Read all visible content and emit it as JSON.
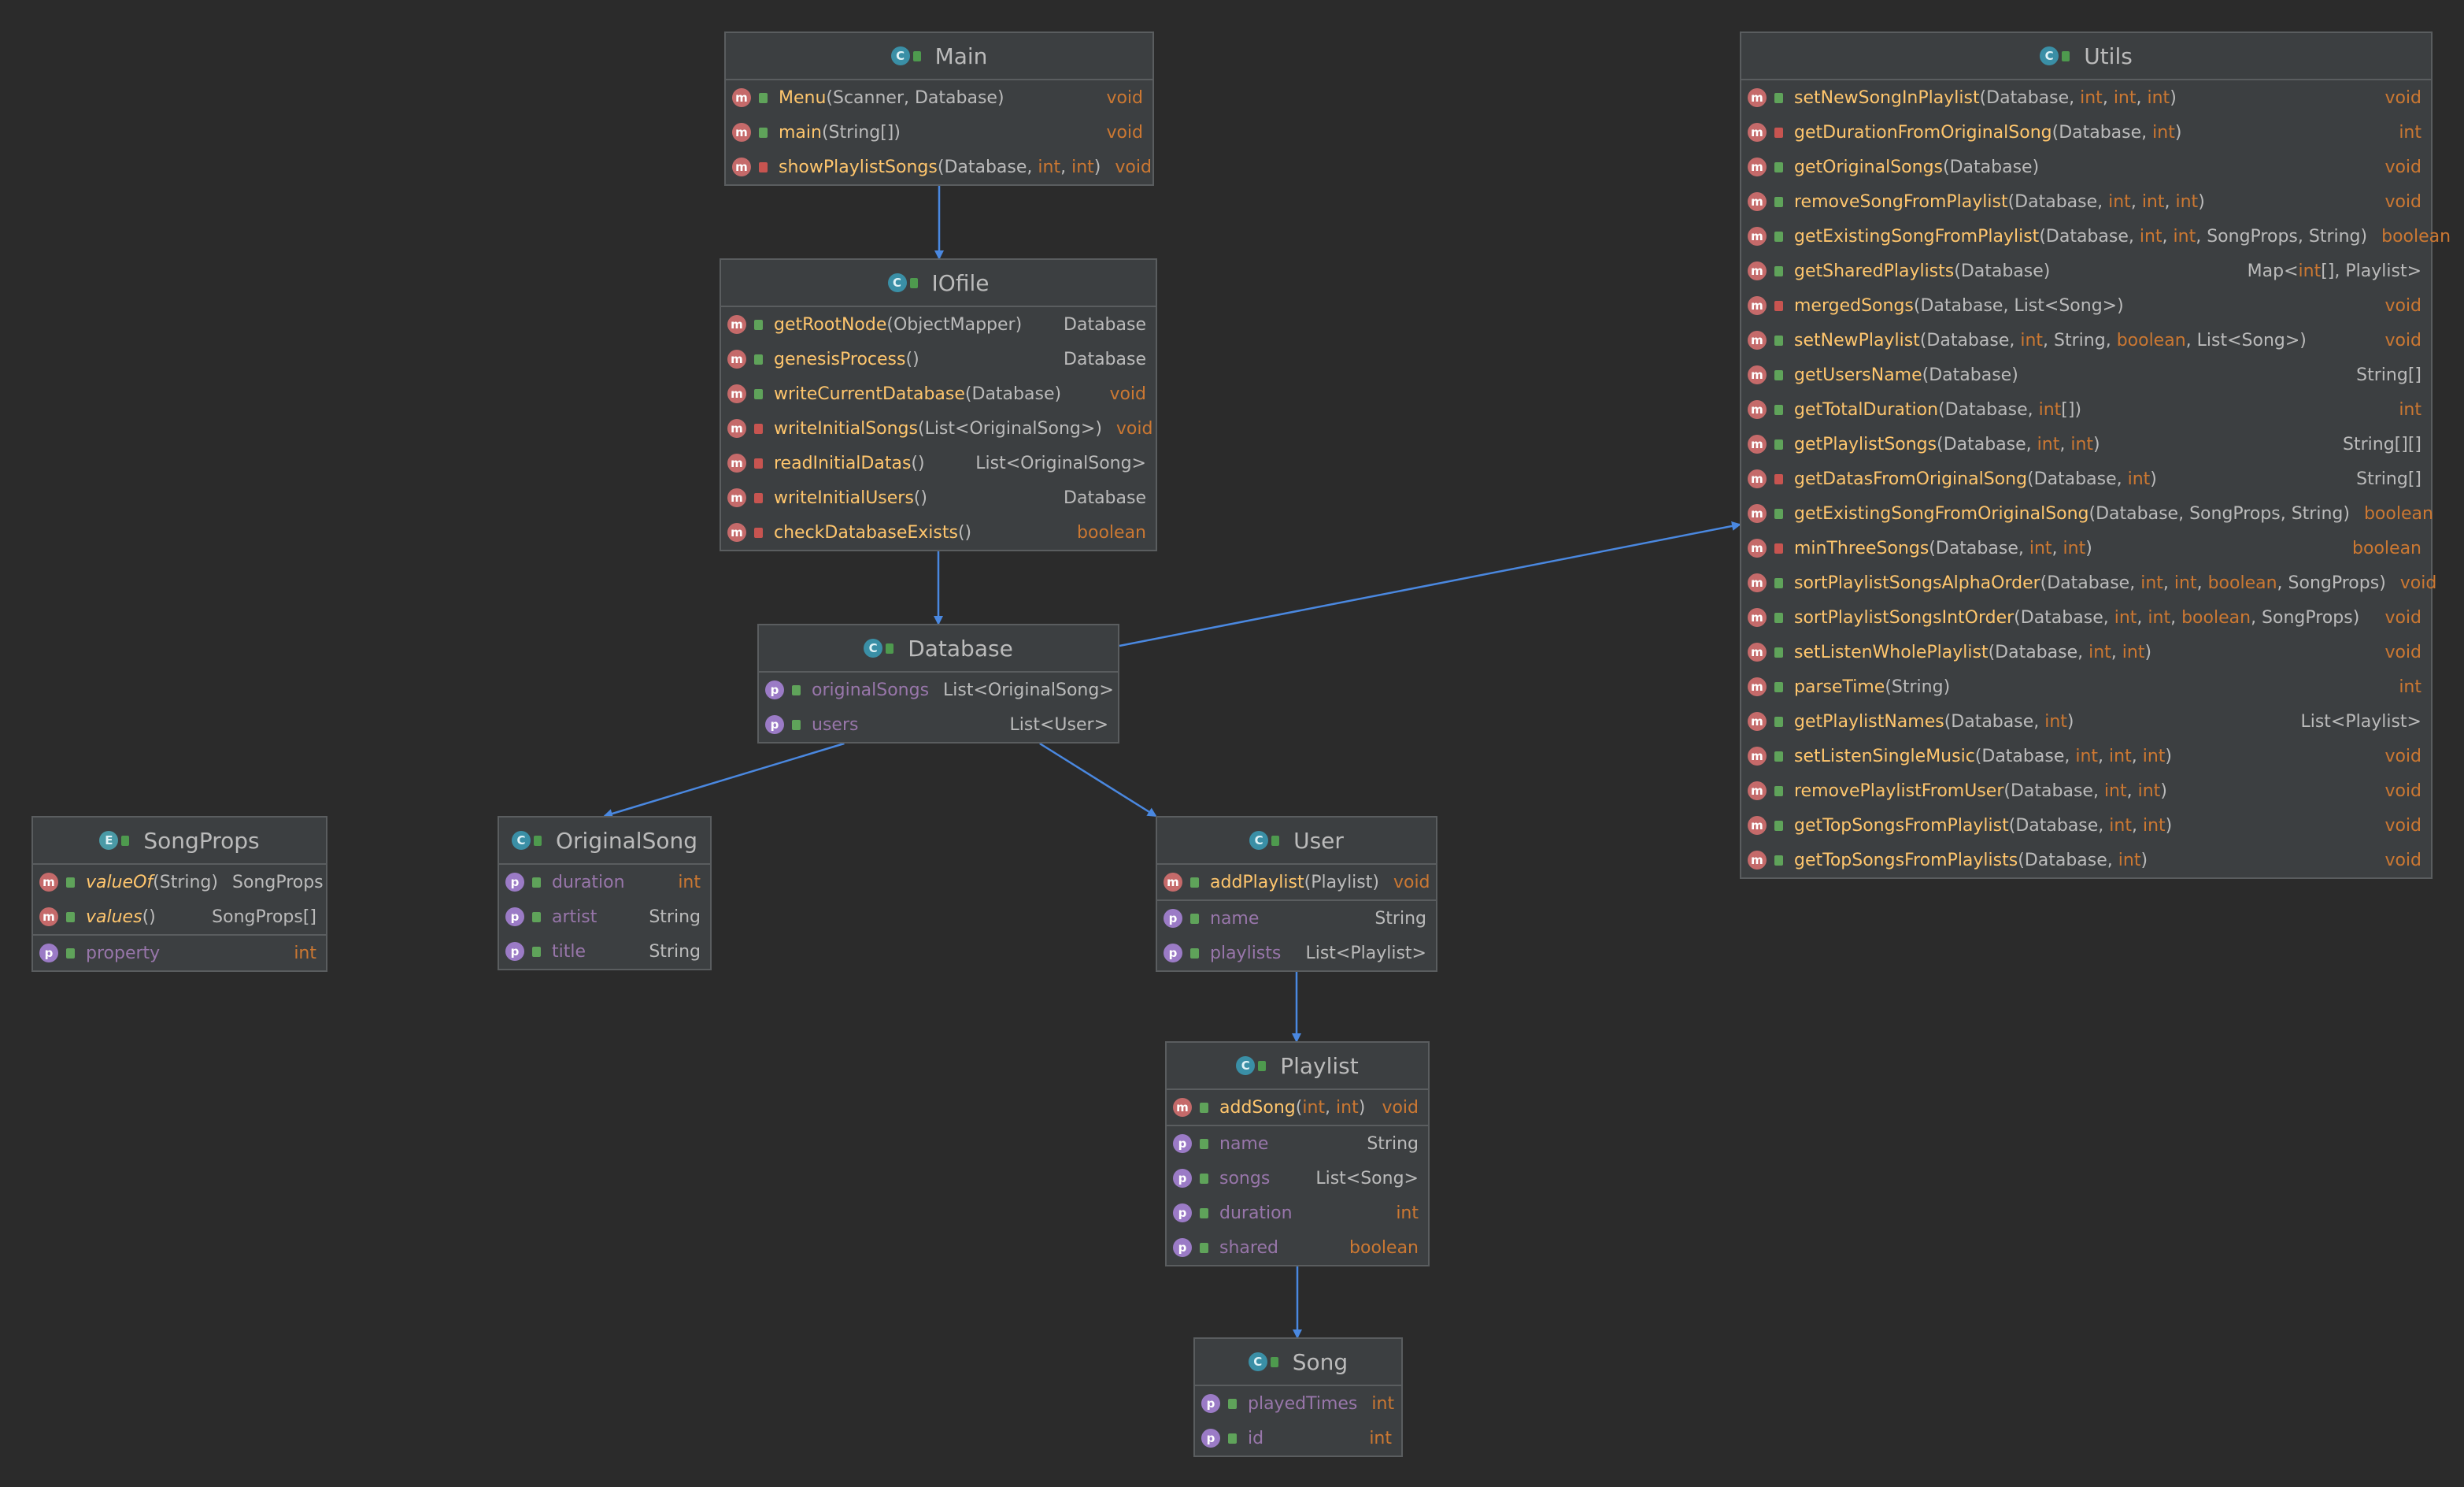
{
  "diagram": {
    "colors": {
      "arrow": "#4a88e0",
      "background": "#2b2b2b",
      "box": "#3c3f41"
    },
    "classes": [
      {
        "id": "main",
        "name": "Main",
        "kind": "C",
        "methods": [
          {
            "vis": "public",
            "name": "Menu",
            "params": "(Scanner, Database)",
            "type": "void"
          },
          {
            "vis": "public",
            "name": "main",
            "params": "(String[])",
            "type": "void"
          },
          {
            "vis": "private",
            "name": "showPlaylistSongs",
            "params": "(Database, int, int)",
            "type": "void"
          }
        ],
        "props": []
      },
      {
        "id": "iofile",
        "name": "IOfile",
        "kind": "C",
        "methods": [
          {
            "vis": "public",
            "name": "getRootNode",
            "params": "(ObjectMapper)",
            "type": "Database"
          },
          {
            "vis": "public",
            "name": "genesisProcess",
            "params": "()",
            "type": "Database"
          },
          {
            "vis": "public",
            "name": "writeCurrentDatabase",
            "params": "(Database)",
            "type": "void"
          },
          {
            "vis": "private",
            "name": "writeInitialSongs",
            "params": "(List<OriginalSong>)",
            "type": "void"
          },
          {
            "vis": "private",
            "name": "readInitialDatas",
            "params": "()",
            "type": "List<OriginalSong>"
          },
          {
            "vis": "private",
            "name": "writeInitialUsers",
            "params": "()",
            "type": "Database"
          },
          {
            "vis": "private",
            "name": "checkDatabaseExists",
            "params": "()",
            "type": "boolean"
          }
        ],
        "props": []
      },
      {
        "id": "database",
        "name": "Database",
        "kind": "C",
        "methods": [],
        "props": [
          {
            "vis": "public",
            "name": "originalSongs",
            "type": "List<OriginalSong>"
          },
          {
            "vis": "public",
            "name": "users",
            "type": "List<User>"
          }
        ]
      },
      {
        "id": "songprops",
        "name": "SongProps",
        "kind": "E",
        "methods": [
          {
            "vis": "public",
            "name": "valueOf",
            "params": "(String)",
            "type": "SongProps",
            "static": true
          },
          {
            "vis": "public",
            "name": "values",
            "params": "()",
            "type": "SongProps[]",
            "static": true
          }
        ],
        "props": [
          {
            "vis": "public",
            "name": "property",
            "type": "int"
          }
        ]
      },
      {
        "id": "originalsong",
        "name": "OriginalSong",
        "kind": "C",
        "methods": [],
        "props": [
          {
            "vis": "public",
            "name": "duration",
            "type": "int"
          },
          {
            "vis": "public",
            "name": "artist",
            "type": "String"
          },
          {
            "vis": "public",
            "name": "title",
            "type": "String"
          }
        ]
      },
      {
        "id": "user",
        "name": "User",
        "kind": "C",
        "methods": [
          {
            "vis": "public",
            "name": "addPlaylist",
            "params": "(Playlist)",
            "type": "void"
          }
        ],
        "props": [
          {
            "vis": "public",
            "name": "name",
            "type": "String"
          },
          {
            "vis": "public",
            "name": "playlists",
            "type": "List<Playlist>"
          }
        ]
      },
      {
        "id": "playlist",
        "name": "Playlist",
        "kind": "C",
        "methods": [
          {
            "vis": "public",
            "name": "addSong",
            "params": "(int, int)",
            "type": "void"
          }
        ],
        "props": [
          {
            "vis": "public",
            "name": "name",
            "type": "String"
          },
          {
            "vis": "public",
            "name": "songs",
            "type": "List<Song>"
          },
          {
            "vis": "public",
            "name": "duration",
            "type": "int"
          },
          {
            "vis": "public",
            "name": "shared",
            "type": "boolean"
          }
        ]
      },
      {
        "id": "song",
        "name": "Song",
        "kind": "C",
        "methods": [],
        "props": [
          {
            "vis": "public",
            "name": "playedTimes",
            "type": "int"
          },
          {
            "vis": "public",
            "name": "id",
            "type": "int"
          }
        ]
      },
      {
        "id": "utils",
        "name": "Utils",
        "kind": "C",
        "methods": [
          {
            "vis": "public",
            "name": "setNewSongInPlaylist",
            "params": "(Database, int, int, int)",
            "type": "void"
          },
          {
            "vis": "private",
            "name": "getDurationFromOriginalSong",
            "params": "(Database, int)",
            "type": "int"
          },
          {
            "vis": "public",
            "name": "getOriginalSongs",
            "params": "(Database)",
            "type": "void"
          },
          {
            "vis": "public",
            "name": "removeSongFromPlaylist",
            "params": "(Database, int, int, int)",
            "type": "void"
          },
          {
            "vis": "public",
            "name": "getExistingSongFromPlaylist",
            "params": "(Database, int, int, SongProps, String)",
            "type": "boolean"
          },
          {
            "vis": "public",
            "name": "getSharedPlaylists",
            "params": "(Database)",
            "type": "Map<int[], Playlist>"
          },
          {
            "vis": "private",
            "name": "mergedSongs",
            "params": "(Database, List<Song>)",
            "type": "void"
          },
          {
            "vis": "public",
            "name": "setNewPlaylist",
            "params": "(Database, int, String, boolean, List<Song>)",
            "type": "void"
          },
          {
            "vis": "public",
            "name": "getUsersName",
            "params": "(Database)",
            "type": "String[]"
          },
          {
            "vis": "public",
            "name": "getTotalDuration",
            "params": "(Database, int[])",
            "type": "int"
          },
          {
            "vis": "public",
            "name": "getPlaylistSongs",
            "params": "(Database, int, int)",
            "type": "String[][]"
          },
          {
            "vis": "private",
            "name": "getDatasFromOriginalSong",
            "params": "(Database, int)",
            "type": "String[]"
          },
          {
            "vis": "public",
            "name": "getExistingSongFromOriginalSong",
            "params": "(Database, SongProps, String)",
            "type": "boolean"
          },
          {
            "vis": "private",
            "name": "minThreeSongs",
            "params": "(Database, int, int)",
            "type": "boolean"
          },
          {
            "vis": "public",
            "name": "sortPlaylistSongsAlphaOrder",
            "params": "(Database, int, int, boolean, SongProps)",
            "type": "void"
          },
          {
            "vis": "public",
            "name": "sortPlaylistSongsIntOrder",
            "params": "(Database, int, int, boolean, SongProps)",
            "type": "void"
          },
          {
            "vis": "public",
            "name": "setListenWholePlaylist",
            "params": "(Database, int, int)",
            "type": "void"
          },
          {
            "vis": "public",
            "name": "parseTime",
            "params": "(String)",
            "type": "int"
          },
          {
            "vis": "public",
            "name": "getPlaylistNames",
            "params": "(Database, int)",
            "type": "List<Playlist>"
          },
          {
            "vis": "public",
            "name": "setListenSingleMusic",
            "params": "(Database, int, int, int)",
            "type": "void"
          },
          {
            "vis": "public",
            "name": "removePlaylistFromUser",
            "params": "(Database, int, int)",
            "type": "void"
          },
          {
            "vis": "public",
            "name": "getTopSongsFromPlaylist",
            "params": "(Database, int, int)",
            "type": "void"
          },
          {
            "vis": "public",
            "name": "getTopSongsFromPlaylists",
            "params": "(Database, int)",
            "type": "void"
          }
        ],
        "props": []
      }
    ],
    "links": [
      {
        "from": "main",
        "to": "iofile"
      },
      {
        "from": "iofile",
        "to": "database"
      },
      {
        "from": "database",
        "to": "utils"
      },
      {
        "from": "database",
        "to": "originalsong"
      },
      {
        "from": "database",
        "to": "user"
      },
      {
        "from": "user",
        "to": "playlist"
      },
      {
        "from": "playlist",
        "to": "song"
      }
    ]
  }
}
